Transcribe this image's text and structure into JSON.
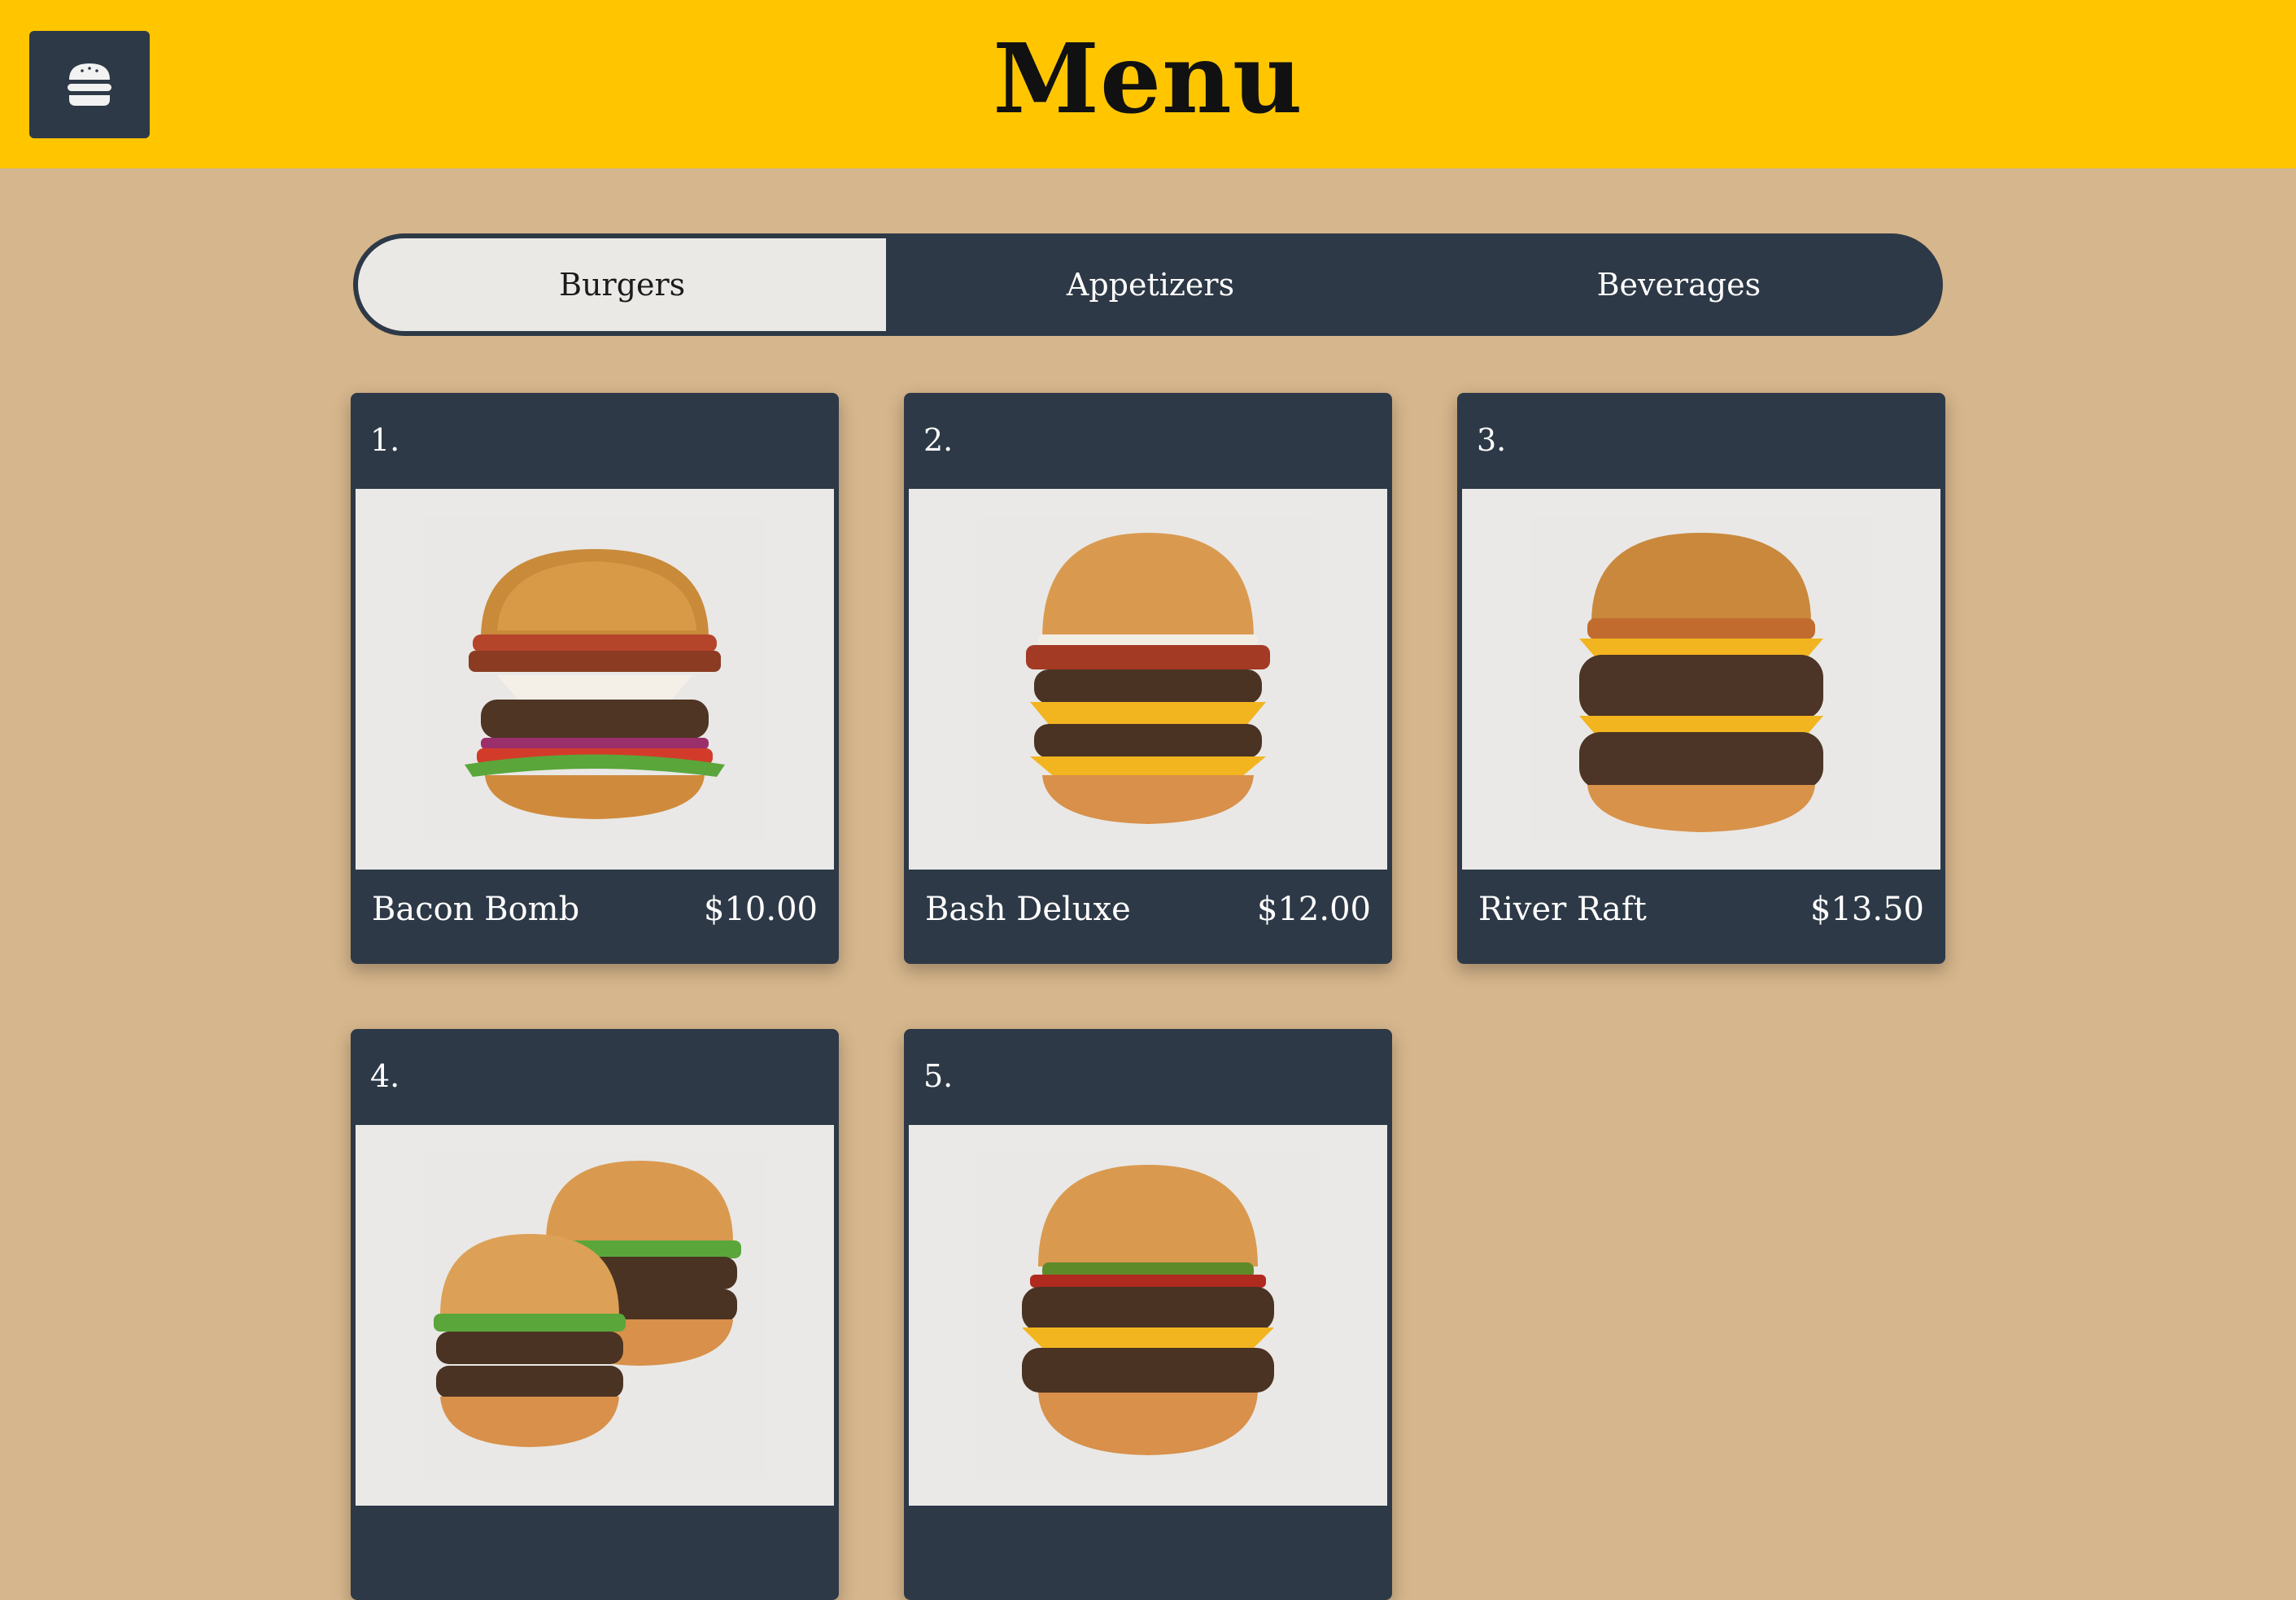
{
  "header": {
    "title": "Menu",
    "menu_icon": "hamburger-icon",
    "bg_color": "#ffc600"
  },
  "tabs": [
    {
      "label": "Burgers",
      "active": true
    },
    {
      "label": "Appetizers",
      "active": false
    },
    {
      "label": "Beverages",
      "active": false
    }
  ],
  "items": [
    {
      "number": "1.",
      "name": "Bacon Bomb",
      "price": "$10.00",
      "image": "bacon-burger-photo"
    },
    {
      "number": "2.",
      "name": "Bash Deluxe",
      "price": "$12.00",
      "image": "double-bacon-cheeseburger-photo"
    },
    {
      "number": "3.",
      "name": "River Raft",
      "price": "$13.50",
      "image": "double-cheeseburger-onions-photo"
    },
    {
      "number": "4.",
      "name": "",
      "price": "",
      "image": "two-burgers-photo"
    },
    {
      "number": "5.",
      "name": "",
      "price": "",
      "image": "double-cheeseburger-pickles-photo"
    }
  ],
  "colors": {
    "page_bg": "#d6b68c",
    "card_bg": "#2e3947",
    "accent": "#ffc600"
  }
}
